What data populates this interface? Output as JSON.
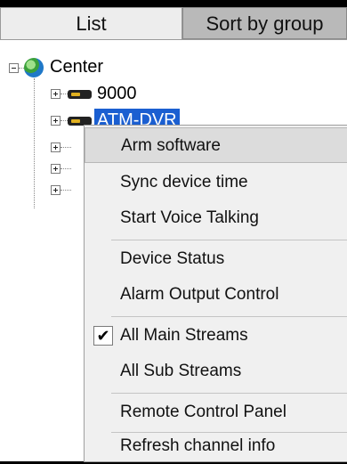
{
  "tabs": {
    "list": "List",
    "sort_by_group": "Sort by group"
  },
  "tree": {
    "root": "Center",
    "devices": [
      "9000",
      "ATM-DVR"
    ]
  },
  "menu": {
    "items": [
      {
        "label": "Arm software",
        "highlighted": true
      },
      {
        "label": "Sync device time"
      },
      {
        "label": "Start Voice Talking"
      },
      {
        "label": "Device Status"
      },
      {
        "label": "Alarm Output Control"
      },
      {
        "label": "All Main Streams",
        "checked": true
      },
      {
        "label": "All Sub Streams"
      },
      {
        "label": "Remote Control Panel"
      },
      {
        "label": "Refresh channel info"
      }
    ]
  },
  "colors": {
    "selection": "#1b5fd1",
    "menu_bg": "#f0f0f0",
    "tab_inactive": "#b9b9b9"
  }
}
